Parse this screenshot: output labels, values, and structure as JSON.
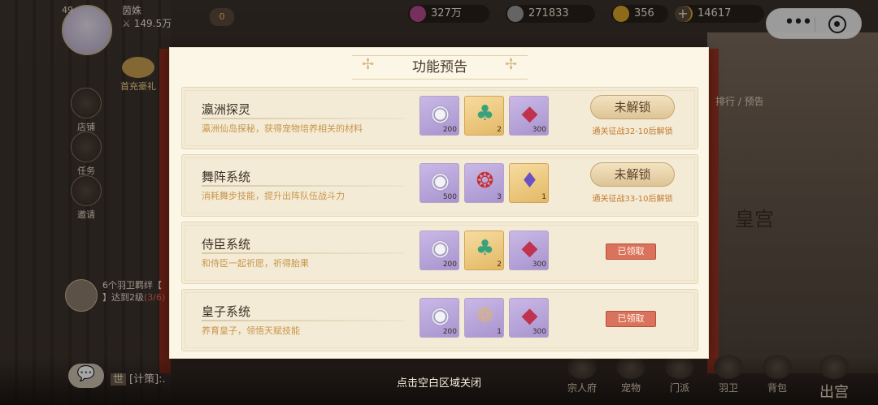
{
  "player": {
    "level": "49",
    "name": "茵姝",
    "power": "149.5万",
    "vip_label": "0"
  },
  "resources": [
    {
      "value": "327万"
    },
    {
      "value": "271833"
    },
    {
      "value": "356"
    },
    {
      "value": "14617"
    }
  ],
  "side_menu": [
    {
      "label": "店铺"
    },
    {
      "label": "任务"
    },
    {
      "label": "邀请"
    }
  ],
  "first_charge": "首充豪礼",
  "task_tip": {
    "text": "6个羽卫羁绊【",
    "text2": "】达到2级",
    "progress": "(3/6)"
  },
  "chat": {
    "tag": "世",
    "text": "[计策]:."
  },
  "right_panel": {
    "palace": "皇宫",
    "rank": "排行 / 预告"
  },
  "dialog": {
    "title": "功能预告",
    "rows": [
      {
        "name": "瀛洲探灵",
        "desc": "瀛洲仙岛探秘，获得宠物培养相关的材料",
        "items": [
          {
            "icon": "silver-coin-icon",
            "count": "200"
          },
          {
            "icon": "jade-pendant-icon",
            "count": "2"
          },
          {
            "icon": "ruby-gem-icon",
            "count": "300"
          }
        ],
        "status": "locked",
        "button": "未解锁",
        "condition": "通关征战32-10后解锁"
      },
      {
        "name": "舞阵系统",
        "desc": "消耗舞步技能，提升出阵队伍战斗力",
        "items": [
          {
            "icon": "silver-coin-icon",
            "count": "500"
          },
          {
            "icon": "red-silk-icon",
            "count": "3"
          },
          {
            "icon": "perfume-bottle-icon",
            "count": "1"
          }
        ],
        "status": "locked",
        "button": "未解锁",
        "condition": "通关征战33-10后解锁"
      },
      {
        "name": "侍臣系统",
        "desc": "和侍臣一起祈愿，祈得胎果",
        "items": [
          {
            "icon": "silver-coin-icon",
            "count": "200"
          },
          {
            "icon": "jade-pendant-icon",
            "count": "2"
          },
          {
            "icon": "ruby-gem-icon",
            "count": "300"
          }
        ],
        "status": "claimed",
        "button": "已领取"
      },
      {
        "name": "皇子系统",
        "desc": "养育皇子，领悟天赋技能",
        "items": [
          {
            "icon": "silver-coin-icon",
            "count": "200"
          },
          {
            "icon": "bun-basket-icon",
            "count": "1"
          },
          {
            "icon": "ruby-gem-icon",
            "count": "300"
          }
        ],
        "status": "claimed",
        "button": "已领取"
      }
    ]
  },
  "close_hint": "点击空白区域关闭",
  "bottom_nav": [
    {
      "label": "宗人府"
    },
    {
      "label": "宠物"
    },
    {
      "label": "门派"
    },
    {
      "label": "羽卫"
    },
    {
      "label": "背包"
    },
    {
      "label": "出宫"
    }
  ],
  "colors": {
    "panel_bg": "#fbf6e6",
    "row_bg": "#f3ebd6",
    "desc_text": "#c8954a",
    "locked_button": "#ddc496",
    "claimed_button": "#d9735e",
    "condition_text": "#c47a2e"
  }
}
